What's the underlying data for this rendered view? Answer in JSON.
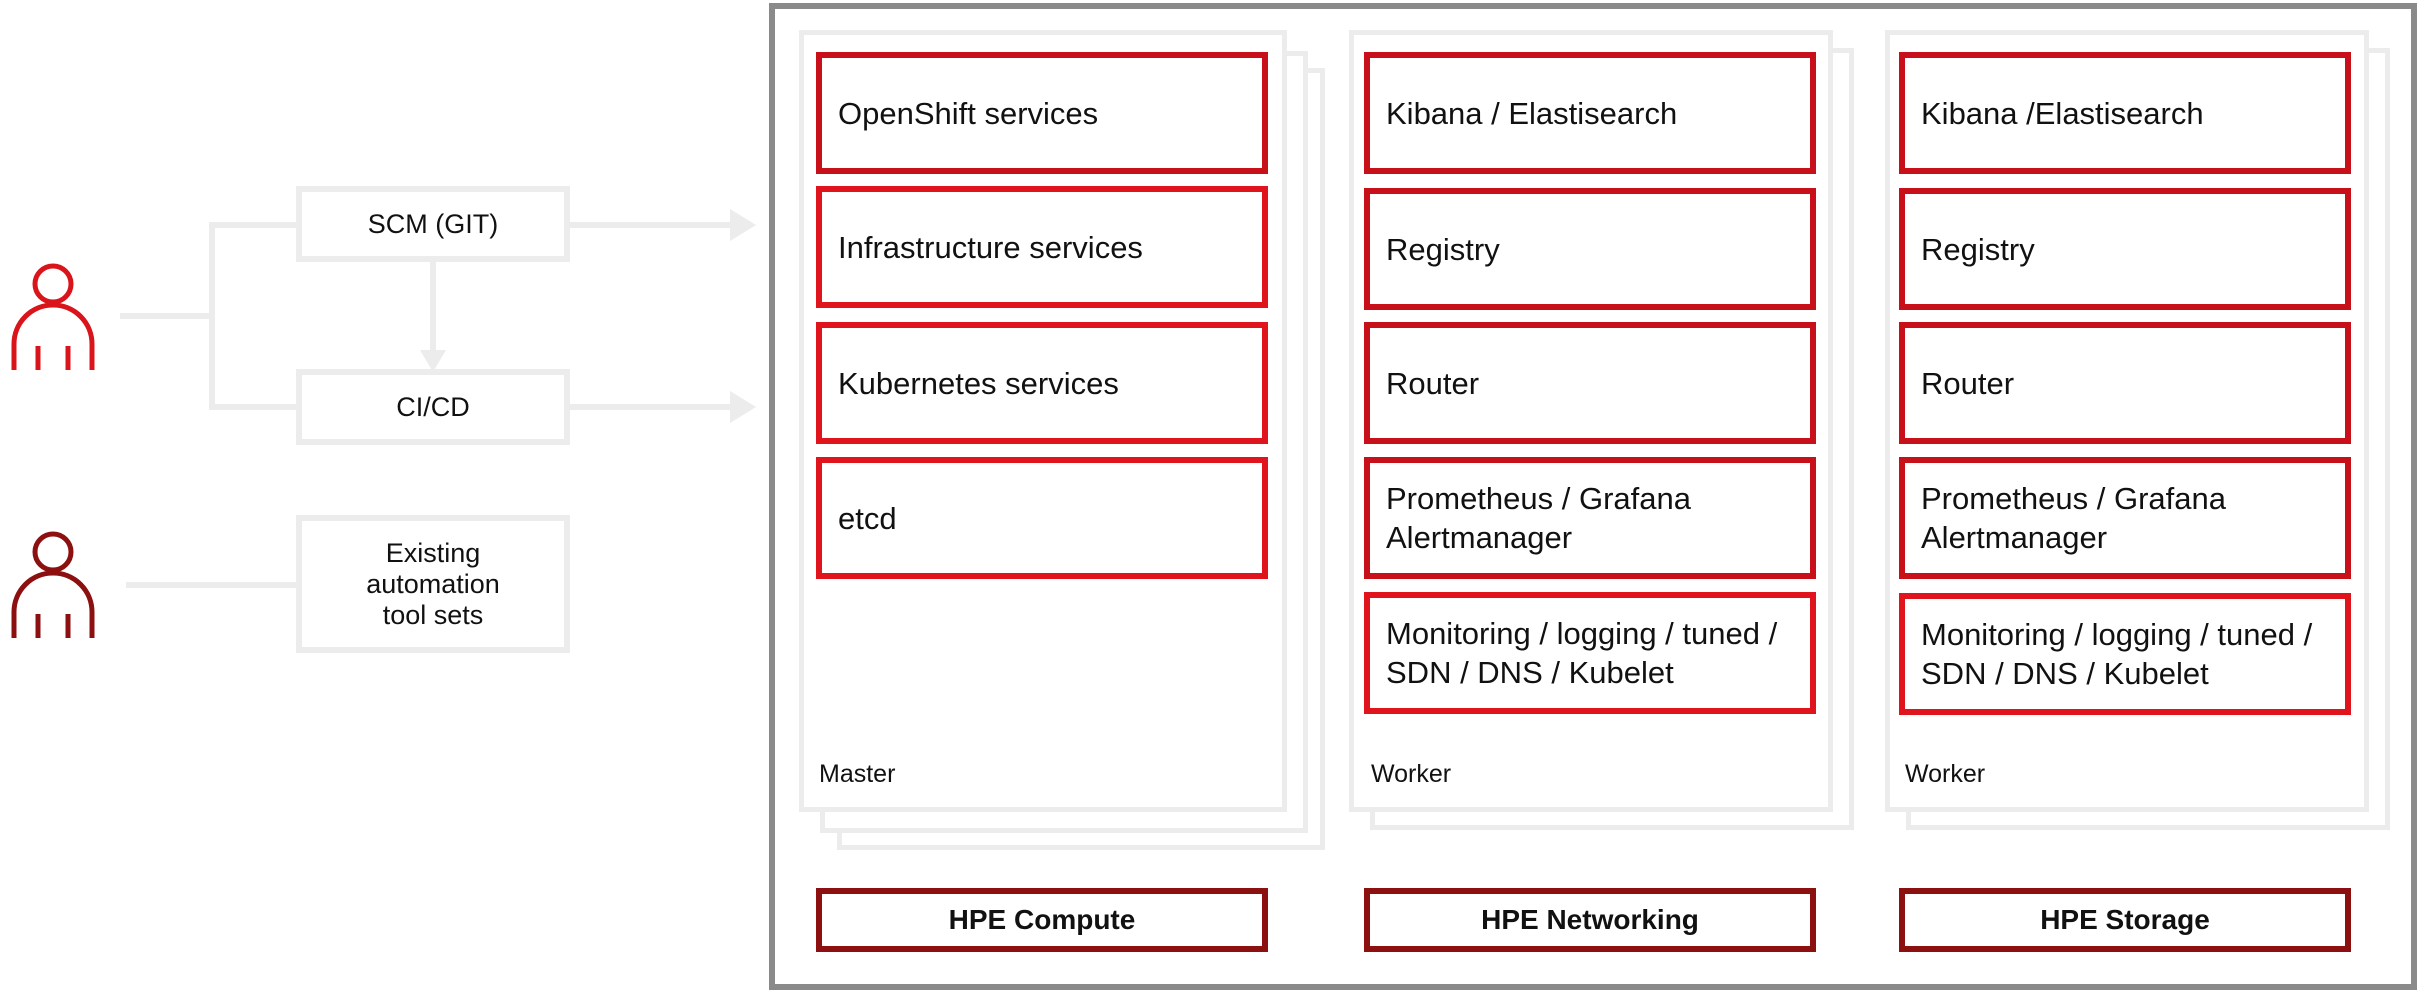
{
  "flow": {
    "scm": "SCM (GIT)",
    "cicd": "CI/CD",
    "existing": "Existing\nautomation\ntool sets"
  },
  "colors": {
    "accent_red": "#e0141c",
    "dark_red": "#8c1010",
    "person_1": "#d9141b",
    "person_2": "#8c1010",
    "line_gray": "#ececec",
    "frame_gray": "#8a8a8a"
  },
  "columns": [
    {
      "label": "Master",
      "services": [
        "OpenShift services",
        "Infrastructure services",
        "Kubernetes services",
        "etcd"
      ],
      "foundation": "HPE Compute"
    },
    {
      "label": "Worker",
      "services": [
        "Kibana / Elastisearch",
        "Registry",
        "Router",
        "Prometheus / Grafana\nAlertmanager",
        "Monitoring / logging / tuned /\nSDN / DNS / Kubelet"
      ],
      "foundation": "HPE Networking"
    },
    {
      "label": "Worker",
      "services": [
        "Kibana /Elastisearch",
        "Registry",
        "Router",
        "Prometheus / Grafana\nAlertmanager",
        "Monitoring / logging / tuned /\nSDN / DNS / Kubelet"
      ],
      "foundation": "HPE Storage"
    }
  ]
}
